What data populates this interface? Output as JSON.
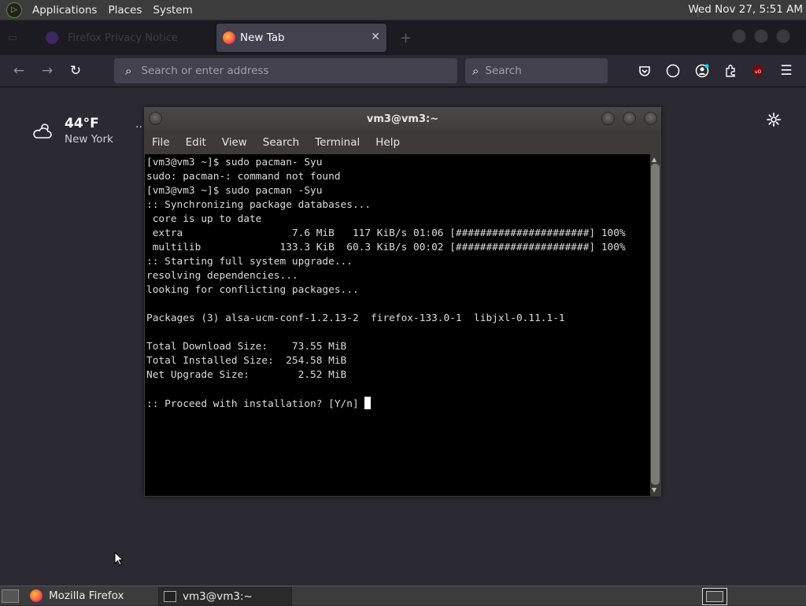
{
  "top_panel": {
    "menus": [
      "Applications",
      "Places",
      "System"
    ],
    "clock": "Wed Nov 27,  5:51 AM"
  },
  "firefox": {
    "faded_tab_label": "Firefox Privacy Notice",
    "active_tab_label": "New Tab",
    "url_placeholder": "Search or enter address",
    "search_placeholder": "Search",
    "weather": {
      "temp": "44°F",
      "city": "New York"
    }
  },
  "terminal": {
    "title": "vm3@vm3:~",
    "menu": [
      "File",
      "Edit",
      "View",
      "Search",
      "Terminal",
      "Help"
    ],
    "lines": [
      "[vm3@vm3 ~]$ sudo pacman- Syu",
      "sudo: pacman-: command not found",
      "[vm3@vm3 ~]$ sudo pacman -Syu",
      ":: Synchronizing package databases...",
      " core is up to date",
      " extra                  7.6 MiB   117 KiB/s 01:06 [######################] 100%",
      " multilib             133.3 KiB  60.3 KiB/s 00:02 [######################] 100%",
      ":: Starting full system upgrade...",
      "resolving dependencies...",
      "looking for conflicting packages...",
      "",
      "Packages (3) alsa-ucm-conf-1.2.13-2  firefox-133.0-1  libjxl-0.11.1-1",
      "",
      "Total Download Size:    73.55 MiB",
      "Total Installed Size:  254.58 MiB",
      "Net Upgrade Size:        2.52 MiB",
      ""
    ],
    "prompt_line": ":: Proceed with installation? [Y/n] "
  },
  "taskbar": {
    "tasks": [
      "Mozilla Firefox",
      "vm3@vm3:~"
    ]
  }
}
